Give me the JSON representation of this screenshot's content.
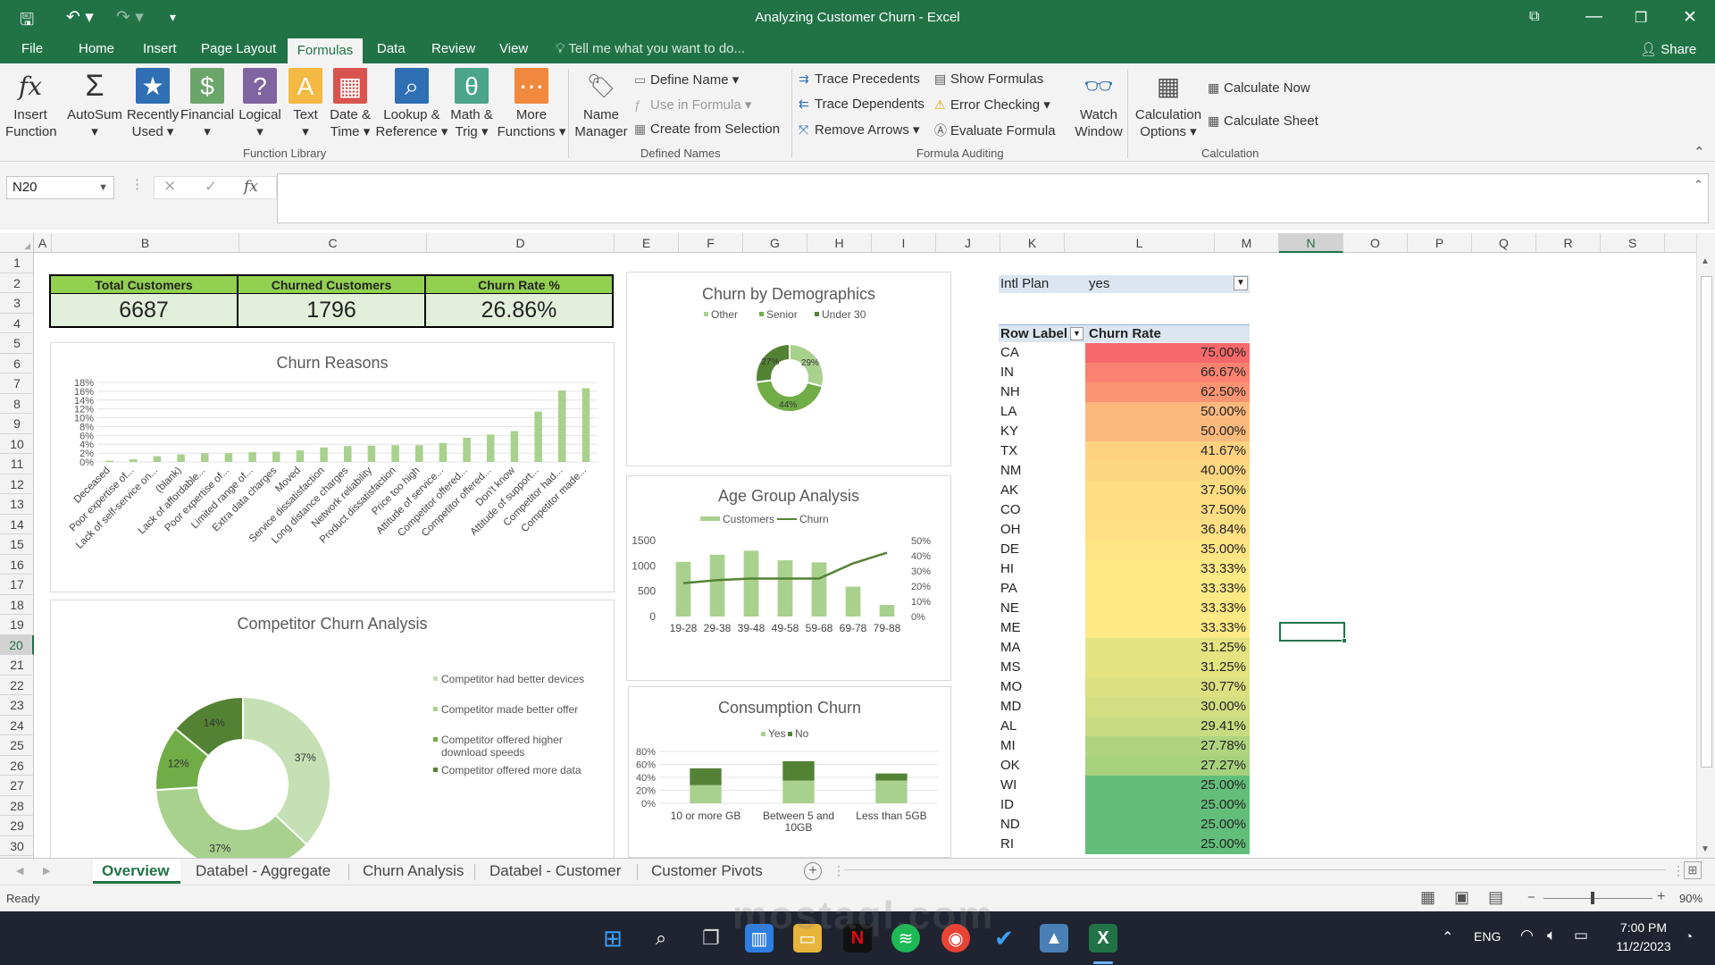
{
  "window": {
    "title": "Analyzing Customer Churn - Excel",
    "restore_icon": "ribbon-display-icon"
  },
  "menu_tabs": [
    {
      "label": "File"
    },
    {
      "label": "Home"
    },
    {
      "label": "Insert"
    },
    {
      "label": "Page Layout"
    },
    {
      "label": "Formulas"
    },
    {
      "label": "Data"
    },
    {
      "label": "Review"
    },
    {
      "label": "View"
    }
  ],
  "tell_me": "Tell me what you want to do...",
  "share": "Share",
  "ribbon": {
    "function_library": {
      "label": "Function Library",
      "buttons": [
        {
          "l1": "Insert",
          "l2": "Function",
          "icon": "fx",
          "color": "#ffffff"
        },
        {
          "l1": "AutoSum",
          "l2": "▾",
          "icon": "Σ",
          "color": "#ffffff"
        },
        {
          "l1": "Recently",
          "l2": "Used ▾",
          "icon": "★",
          "color": "#2f6fb3"
        },
        {
          "l1": "Financial",
          "l2": "▾",
          "icon": "$",
          "color": "#6aa66a"
        },
        {
          "l1": "Logical",
          "l2": "▾",
          "icon": "?",
          "color": "#8064a2"
        },
        {
          "l1": "Text",
          "l2": "▾",
          "icon": "A",
          "color": "#f4b942"
        },
        {
          "l1": "Date &",
          "l2": "Time ▾",
          "icon": "▦",
          "color": "#d9534f"
        },
        {
          "l1": "Lookup &",
          "l2": "Reference ▾",
          "icon": "⌕",
          "color": "#2f6fb3"
        },
        {
          "l1": "Math &",
          "l2": "Trig ▾",
          "icon": "θ",
          "color": "#4aa58a"
        },
        {
          "l1": "More",
          "l2": "Functions ▾",
          "icon": "⋯",
          "color": "#f0883e"
        }
      ]
    },
    "defined_names": {
      "label": "Defined Names",
      "name_manager": {
        "l1": "Name",
        "l2": "Manager"
      },
      "define_name": "Define Name ▾",
      "use_in_formula": "Use in Formula ▾",
      "create_from_selection": "Create from Selection"
    },
    "formula_auditing": {
      "label": "Formula Auditing",
      "trace_precedents": "Trace Precedents",
      "trace_dependents": "Trace Dependents",
      "remove_arrows": "Remove Arrows ▾",
      "show_formulas": "Show Formulas",
      "error_checking": "Error Checking ▾",
      "evaluate_formula": "Evaluate Formula",
      "watch_window": {
        "l1": "Watch",
        "l2": "Window"
      }
    },
    "calculation": {
      "label": "Calculation",
      "options": {
        "l1": "Calculation",
        "l2": "Options ▾"
      },
      "calculate_now": "Calculate Now",
      "calculate_sheet": "Calculate Sheet"
    }
  },
  "formula_bar": {
    "name_box": "N20",
    "fx": "fx",
    "value": ""
  },
  "columns": [
    "A",
    "B",
    "C",
    "D",
    "E",
    "F",
    "G",
    "H",
    "I",
    "J",
    "K",
    "L",
    "M",
    "N",
    "O",
    "P",
    "Q",
    "R",
    "S"
  ],
  "rows": [
    "1",
    "2",
    "3",
    "4",
    "5",
    "6",
    "7",
    "8",
    "9",
    "10",
    "11",
    "12",
    "13",
    "14",
    "15",
    "16",
    "17",
    "18",
    "19",
    "20",
    "21",
    "22",
    "23",
    "24",
    "25",
    "26",
    "27",
    "28",
    "29",
    "30"
  ],
  "kpis": [
    {
      "label": "Total Customers",
      "value": "6687"
    },
    {
      "label": "Churned Customers",
      "value": "1796"
    },
    {
      "label": "Churn Rate %",
      "value": "26.86%"
    }
  ],
  "chart_data": [
    {
      "type": "bar",
      "title": "Churn Reasons",
      "categories": [
        "Deceased",
        "Poor expertise of...",
        "Lack of self-service on...",
        "(blank)",
        "Lack of affordable...",
        "Poor expertise of...",
        "Limited range of...",
        "Extra data charges",
        "Moved",
        "Service dissatisfaction",
        "Long distance charges",
        "Network reliability",
        "Product dissatisfaction",
        "Price too high",
        "Attitude of service...",
        "Competitor offered...",
        "Competitor offered...",
        "Don't know",
        "Attitude of support...",
        "Competitor had...",
        "Competitor made..."
      ],
      "values": [
        0.3,
        0.6,
        1.3,
        1.7,
        2.0,
        2.0,
        2.2,
        2.3,
        2.6,
        3.3,
        3.6,
        3.7,
        3.8,
        3.8,
        4.3,
        5.5,
        6.2,
        7.0,
        11.4,
        16.2,
        16.7
      ],
      "yticks": [
        "18%",
        "16%",
        "14%",
        "12%",
        "10%",
        "8%",
        "6%",
        "4%",
        "2%",
        "0%"
      ],
      "ylim": [
        0,
        18
      ],
      "color": "#a9d18e"
    },
    {
      "type": "pie",
      "title": "Churn by Demographics",
      "legend": [
        "Other",
        "Senior",
        "Under 30"
      ],
      "slices": [
        {
          "name": "Other",
          "value": 29,
          "label": "29%",
          "color": "#a9d18e"
        },
        {
          "name": "Senior",
          "value": 44,
          "label": "44%",
          "color": "#70ad47"
        },
        {
          "name": "Under 30",
          "value": 27,
          "label": "27%",
          "color": "#548235"
        }
      ]
    },
    {
      "type": "bar",
      "title": "Age Group Analysis",
      "legend": [
        "Customers",
        "Churn"
      ],
      "categories": [
        "19-28",
        "29-38",
        "39-48",
        "49-58",
        "59-68",
        "69-78",
        "79-88"
      ],
      "series": [
        {
          "name": "Customers",
          "values": [
            1080,
            1220,
            1300,
            1110,
            1070,
            590,
            230
          ],
          "color": "#a9d18e"
        },
        {
          "name": "Churn",
          "values": [
            22,
            24,
            25,
            25,
            25,
            35,
            42
          ],
          "color": "#548235"
        }
      ],
      "yticks_left": [
        "1500",
        "1000",
        "500",
        "0"
      ],
      "yticks_right": [
        "50%",
        "40%",
        "30%",
        "20%",
        "10%",
        "0%"
      ],
      "ylim": [
        0,
        1500
      ],
      "y2lim": [
        0,
        50
      ]
    },
    {
      "type": "bar",
      "title": "Consumption Churn",
      "legend": [
        "Yes",
        "No"
      ],
      "categories": [
        "10 or more GB",
        "Between 5 and 10GB",
        "Less than 5GB"
      ],
      "series": [
        {
          "name": "Yes",
          "values": [
            28,
            35,
            35
          ],
          "color": "#a9d18e"
        },
        {
          "name": "No",
          "values": [
            26,
            30,
            11
          ],
          "color": "#548235"
        }
      ],
      "yticks": [
        "80%",
        "60%",
        "40%",
        "20%",
        "0%"
      ],
      "ylim": [
        0,
        80
      ]
    },
    {
      "type": "pie",
      "title": "Competitor Churn Analysis",
      "legend": [
        "Competitor had better devices",
        "Competitor made better offer",
        "Competitor offered higher download speeds",
        "Competitor offered more data"
      ],
      "slices": [
        {
          "name": "Competitor had better devices",
          "value": 37,
          "label": "37%",
          "color": "#c5e0b4"
        },
        {
          "name": "Competitor made better offer",
          "value": 37,
          "label": "37%",
          "color": "#a9d18e"
        },
        {
          "name": "Competitor offered higher download speeds",
          "value": 12,
          "label": "12%",
          "color": "#70ad47"
        },
        {
          "name": "Competitor offered more data",
          "value": 14,
          "label": "14%",
          "color": "#548235"
        }
      ]
    }
  ],
  "pivot": {
    "filter_label": "Intl Plan",
    "filter_value": "yes",
    "header_label": "Row Label",
    "header_value": "Churn Rate",
    "rows": [
      {
        "state": "CA",
        "rate": "75.00%",
        "color": "#f8696b"
      },
      {
        "state": "IN",
        "rate": "66.67%",
        "color": "#f98370"
      },
      {
        "state": "NH",
        "rate": "62.50%",
        "color": "#fa9473"
      },
      {
        "state": "LA",
        "rate": "50.00%",
        "color": "#fcb97c"
      },
      {
        "state": "KY",
        "rate": "50.00%",
        "color": "#fcb97c"
      },
      {
        "state": "TX",
        "rate": "41.67%",
        "color": "#fed280"
      },
      {
        "state": "NM",
        "rate": "40.00%",
        "color": "#fed681"
      },
      {
        "state": "AK",
        "rate": "37.50%",
        "color": "#fedd82"
      },
      {
        "state": "CO",
        "rate": "37.50%",
        "color": "#fedd82"
      },
      {
        "state": "OH",
        "rate": "36.84%",
        "color": "#fedf83"
      },
      {
        "state": "DE",
        "rate": "35.00%",
        "color": "#ffe483"
      },
      {
        "state": "HI",
        "rate": "33.33%",
        "color": "#ffe984"
      },
      {
        "state": "PA",
        "rate": "33.33%",
        "color": "#ffe984"
      },
      {
        "state": "NE",
        "rate": "33.33%",
        "color": "#ffe984"
      },
      {
        "state": "ME",
        "rate": "33.33%",
        "color": "#ffe984"
      },
      {
        "state": "MA",
        "rate": "31.25%",
        "color": "#e3e382"
      },
      {
        "state": "MS",
        "rate": "31.25%",
        "color": "#e3e382"
      },
      {
        "state": "MO",
        "rate": "30.77%",
        "color": "#dce081"
      },
      {
        "state": "MD",
        "rate": "30.00%",
        "color": "#d2de81"
      },
      {
        "state": "AL",
        "rate": "29.41%",
        "color": "#c9db80"
      },
      {
        "state": "MI",
        "rate": "27.78%",
        "color": "#aed47f"
      },
      {
        "state": "OK",
        "rate": "27.27%",
        "color": "#a6d27e"
      },
      {
        "state": "WI",
        "rate": "25.00%",
        "color": "#63be7b"
      },
      {
        "state": "ID",
        "rate": "25.00%",
        "color": "#63be7b"
      },
      {
        "state": "ND",
        "rate": "25.00%",
        "color": "#63be7b"
      },
      {
        "state": "RI",
        "rate": "25.00%",
        "color": "#63be7b"
      }
    ]
  },
  "sheet_tabs": [
    {
      "label": "Overview"
    },
    {
      "label": "Databel - Aggregate"
    },
    {
      "label": "Churn Analysis"
    },
    {
      "label": "Databel - Customer"
    },
    {
      "label": "Customer Pivots"
    }
  ],
  "status": {
    "ready": "Ready",
    "zoom": "90%"
  },
  "taskbar": {
    "lang": "ENG",
    "time": "7:00 PM",
    "date": "11/2/2023"
  },
  "watermark": "mostaql.com"
}
